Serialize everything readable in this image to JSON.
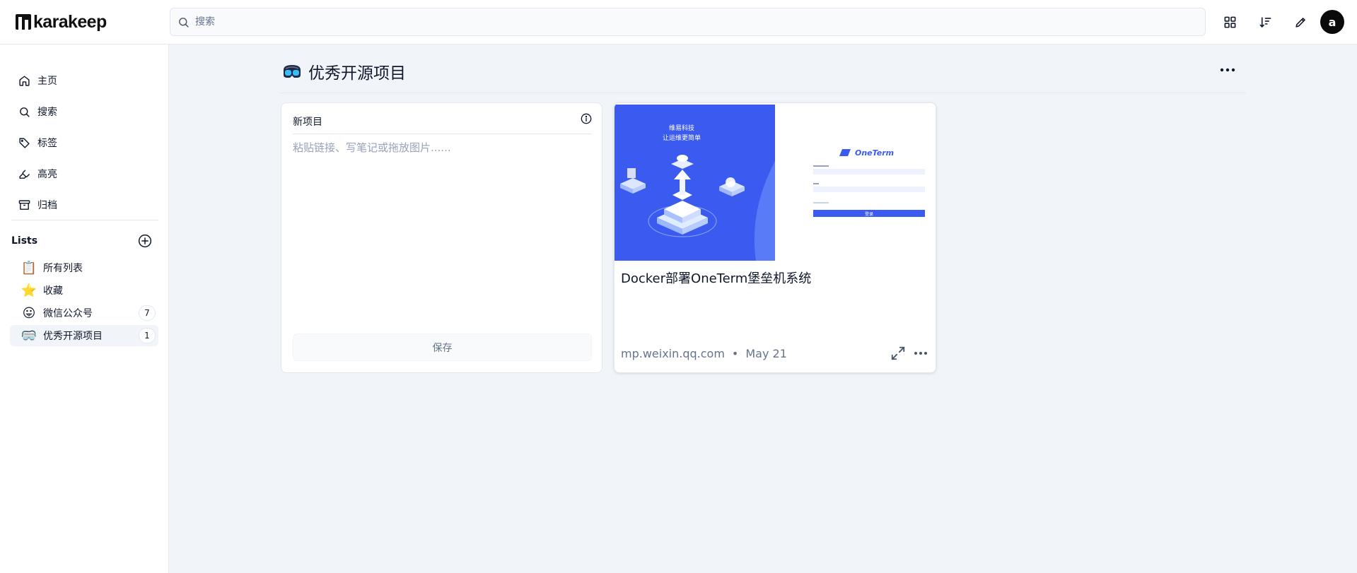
{
  "app": {
    "name": "karakeep"
  },
  "header": {
    "search_placeholder": "搜索",
    "avatar_initial": "a"
  },
  "sidebar": {
    "nav": [
      {
        "label": "主页",
        "icon": "home-icon"
      },
      {
        "label": "搜索",
        "icon": "search-icon"
      },
      {
        "label": "标签",
        "icon": "tag-icon"
      },
      {
        "label": "高亮",
        "icon": "highlighter-icon"
      },
      {
        "label": "归档",
        "icon": "archive-icon"
      }
    ],
    "lists_title": "Lists",
    "lists": [
      {
        "label": "所有列表",
        "emoji": "📋",
        "count": ""
      },
      {
        "label": "收藏",
        "emoji": "⭐",
        "count": ""
      },
      {
        "label": "微信公众号",
        "emoji": "😛",
        "count": "7"
      },
      {
        "label": "优秀开源项目",
        "emoji": "🥽",
        "count": "1",
        "active": true
      }
    ]
  },
  "main": {
    "title": "优秀开源项目",
    "new_item": {
      "title": "新项目",
      "placeholder": "粘贴链接、写笔记或拖放图片......",
      "save_label": "保存"
    },
    "bookmarks": [
      {
        "title": "Docker部署OneTerm堡垒机系统",
        "domain": "mp.weixin.qq.com",
        "separator": "•",
        "date": "May 21",
        "thumbnail": {
          "headline_line1": "维易科技",
          "headline_line2": "让运维更简单",
          "brand": "OneTerm",
          "login_label": "登录"
        }
      }
    ]
  },
  "colors": {
    "accent_blue": "#3b5bf0",
    "background": "#f1f5f9",
    "text": "#0f172a",
    "muted": "#64748b"
  }
}
